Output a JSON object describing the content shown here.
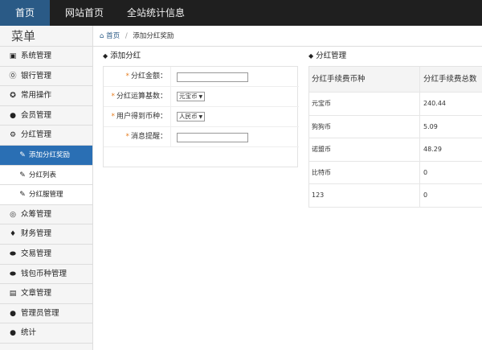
{
  "topnav": [
    {
      "label": "首页",
      "active": true
    },
    {
      "label": "网站首页",
      "active": false
    },
    {
      "label": "全站统计信息",
      "active": false
    }
  ],
  "sidebar": {
    "title": "菜单",
    "items": [
      {
        "label": "系统管理",
        "icon": "grid-icon"
      },
      {
        "label": "银行管理",
        "icon": "bank-icon"
      },
      {
        "label": "常用操作",
        "icon": "star-icon"
      },
      {
        "label": "会员管理",
        "icon": "user-icon"
      },
      {
        "label": "分红管理",
        "icon": "gear-icon"
      },
      {
        "label": "添加分红奖励",
        "icon": "wrench-icon",
        "sub": true,
        "active": true
      },
      {
        "label": "分红列表",
        "icon": "wrench-icon",
        "sub": true
      },
      {
        "label": "分红服管理",
        "icon": "wrench-icon",
        "sub": true
      },
      {
        "label": "众筹管理",
        "icon": "crowdfund-icon"
      },
      {
        "label": "财务管理",
        "icon": "money-bag-icon"
      },
      {
        "label": "交易管理",
        "icon": "exchange-icon"
      },
      {
        "label": "钱包币种管理",
        "icon": "wallet-icon"
      },
      {
        "label": "文章管理",
        "icon": "document-icon"
      },
      {
        "label": "管理员管理",
        "icon": "admin-user-icon"
      },
      {
        "label": "统计",
        "icon": "stats-user-icon"
      }
    ]
  },
  "breadcrumb": {
    "home": "首页",
    "current": "添加分红奖励"
  },
  "form": {
    "title": "添加分红",
    "fields": {
      "amount_label": "分红金额：",
      "base_label": "分红运算基数：",
      "base_value": "元宝币",
      "currency_label": "用户得到币种：",
      "currency_value": "人民币",
      "message_label": "消息提醒："
    }
  },
  "table": {
    "title": "分红管理",
    "headers": [
      "分红手续费币种",
      "分红手续费总数"
    ],
    "rows": [
      [
        "元宝币",
        "240.44"
      ],
      [
        "狗狗币",
        "5.09"
      ],
      [
        "诺盟币",
        "48.29"
      ],
      [
        "比特币",
        "0"
      ],
      [
        "123",
        "0"
      ]
    ]
  },
  "colors": {
    "topbar": "#1f1f1f",
    "nav_active": "#2a5a86",
    "side_active": "#2a6fb4",
    "required": "#e67e22"
  }
}
